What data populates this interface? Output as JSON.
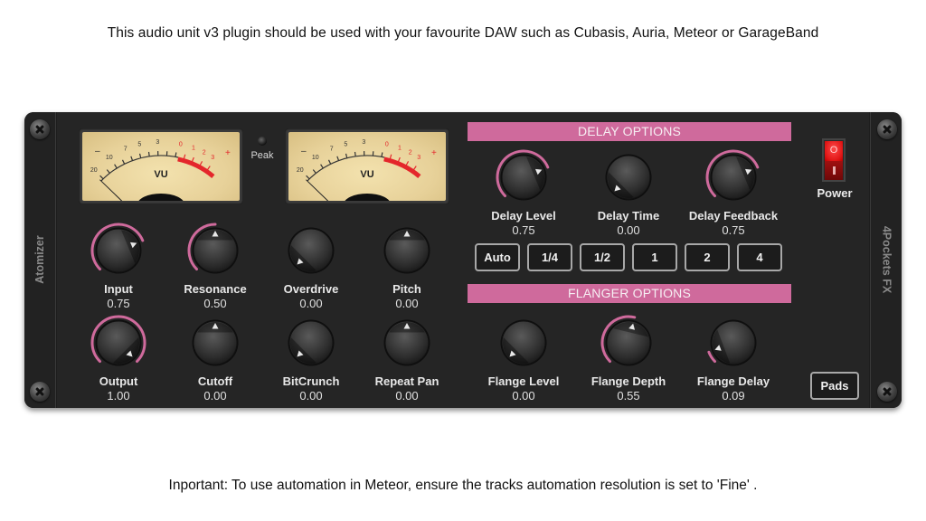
{
  "captions": {
    "top": "This audio unit v3 plugin should be used with your favourite DAW such as Cubasis, Auria, Meteor or GarageBand",
    "bottom": "Inportant: To use automation in Meteor, ensure the tracks automation resolution is set to 'Fine' ."
  },
  "plugin": {
    "name": "Atomizer",
    "brand": "4Pockets FX",
    "accent_color": "#cf6a9c",
    "peak_label": "Peak",
    "vu_meters": [
      {
        "label": "VU",
        "scale": [
          "20",
          "10",
          "7",
          "5",
          "3",
          "0",
          "1",
          "2",
          "3"
        ],
        "minus": "–",
        "plus": "+"
      },
      {
        "label": "VU",
        "scale": [
          "20",
          "10",
          "7",
          "5",
          "3",
          "0",
          "1",
          "2",
          "3"
        ],
        "minus": "–",
        "plus": "+"
      }
    ],
    "main_knobs": [
      {
        "label": "Input",
        "value": "0.75",
        "norm": 0.75,
        "arc": true
      },
      {
        "label": "Resonance",
        "value": "0.50",
        "norm": 0.5,
        "arc": true
      },
      {
        "label": "Overdrive",
        "value": "0.00",
        "norm": 0.0,
        "arc": false
      },
      {
        "label": "Pitch",
        "value": "0.00",
        "norm": 0.5,
        "arc": false
      },
      {
        "label": "Output",
        "value": "1.00",
        "norm": 1.0,
        "arc": true
      },
      {
        "label": "Cutoff",
        "value": "0.00",
        "norm": 0.5,
        "arc": false
      },
      {
        "label": "BitCrunch",
        "value": "0.00",
        "norm": 0.0,
        "arc": false
      },
      {
        "label": "Repeat Pan",
        "value": "0.00",
        "norm": 0.5,
        "arc": false
      }
    ],
    "delay": {
      "title": "DELAY OPTIONS",
      "knobs": [
        {
          "label": "Delay Level",
          "value": "0.75",
          "norm": 0.75,
          "arc": true
        },
        {
          "label": "Delay Time",
          "value": "0.00",
          "norm": 0.0,
          "arc": false
        },
        {
          "label": "Delay Feedback",
          "value": "0.75",
          "norm": 0.75,
          "arc": true
        }
      ],
      "sync_buttons": [
        "Auto",
        "1/4",
        "1/2",
        "1",
        "2",
        "4"
      ]
    },
    "flanger": {
      "title": "FLANGER OPTIONS",
      "knobs": [
        {
          "label": "Flange Level",
          "value": "0.00",
          "norm": 0.0,
          "arc": false
        },
        {
          "label": "Flange Depth",
          "value": "0.55",
          "norm": 0.55,
          "arc": true
        },
        {
          "label": "Flange Delay",
          "value": "0.09",
          "norm": 0.09,
          "arc": true
        }
      ]
    },
    "power": {
      "label": "Power",
      "on_glyph": "O",
      "state": "on"
    },
    "pads_button": "Pads"
  }
}
